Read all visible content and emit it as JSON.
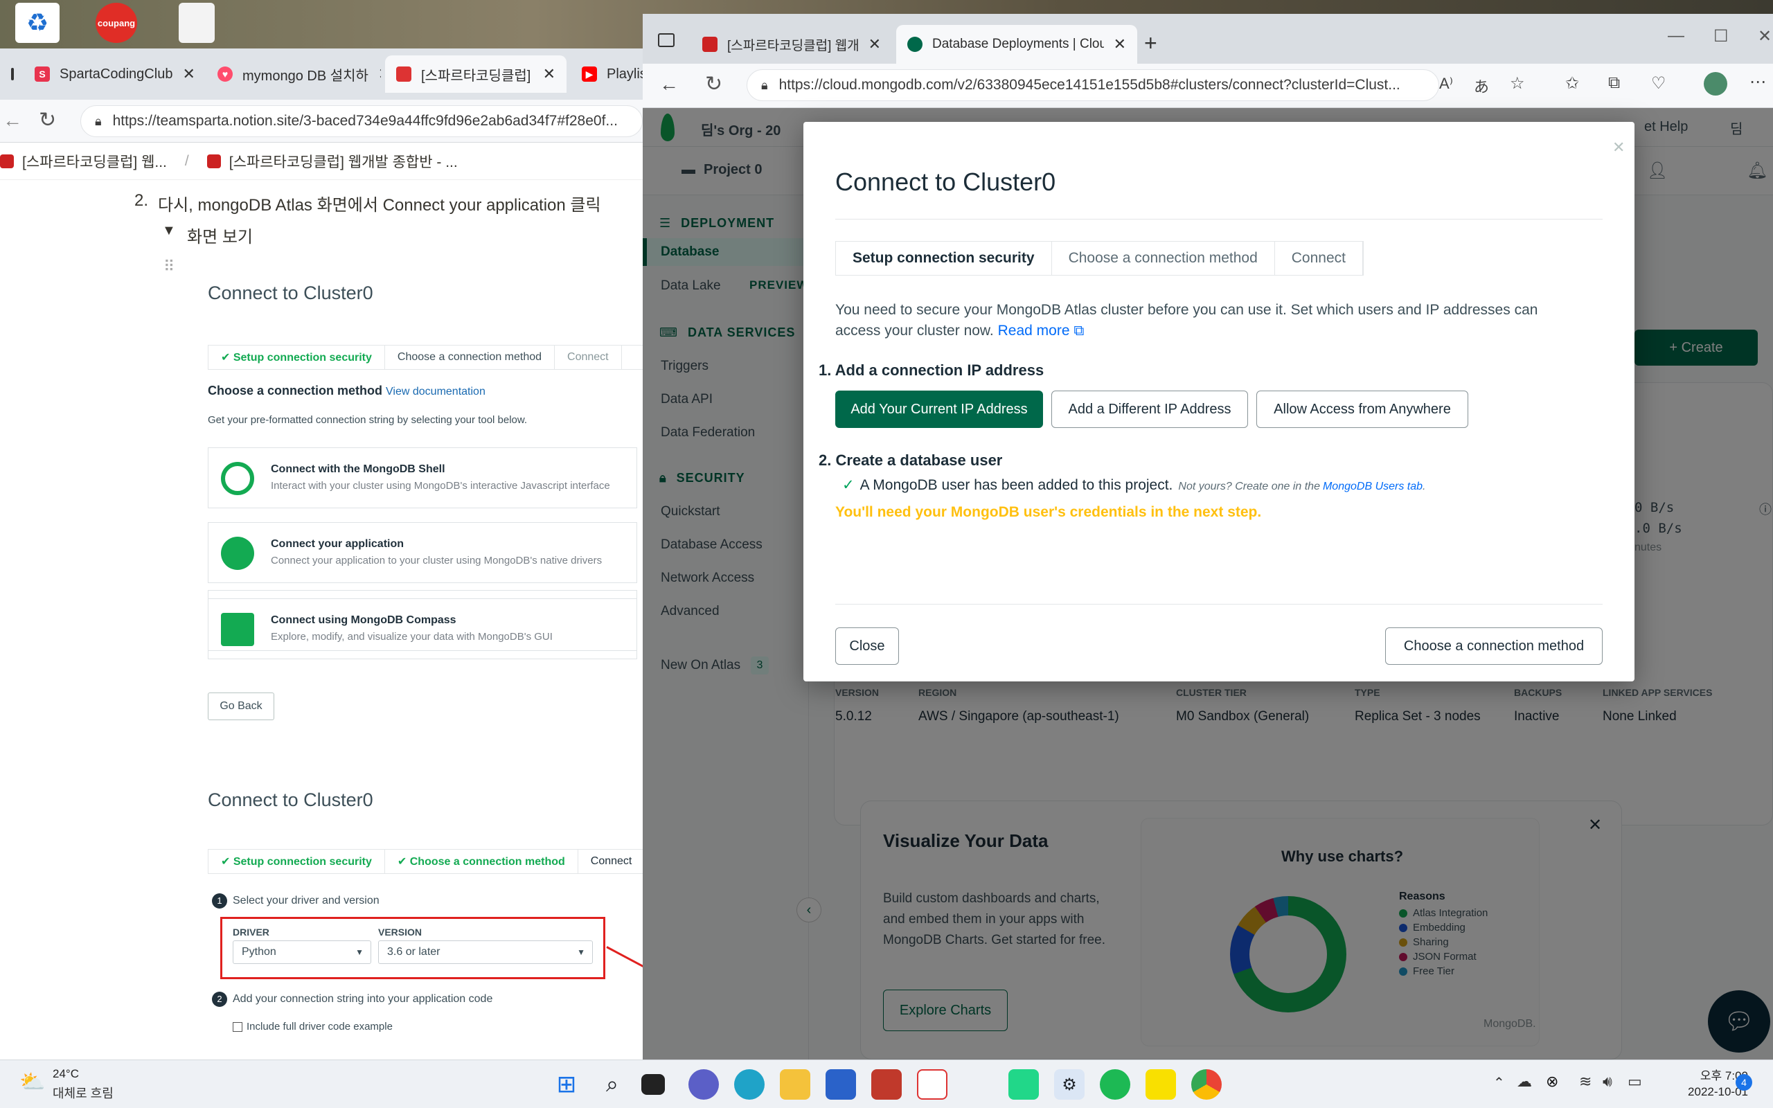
{
  "desktop": {
    "coupang_label": "coupang"
  },
  "left_browser": {
    "tabs": [
      {
        "label": "SpartaCodingClub"
      },
      {
        "label": "mymongo DB 설치하"
      },
      {
        "label": "[스파르타코딩클럽]"
      },
      {
        "label": "Playlis"
      }
    ],
    "url": "https://teamsparta.notion.site/3-baced734e9a44ffc9fd96e2ab6ad34f7#f28e0f...",
    "breadcrumb": [
      "[스파르타코딩클럽] 웹...",
      "/",
      "[스파르타코딩클럽] 웹개발 종합반 - ..."
    ],
    "step_number": "2.",
    "step_text": "다시, mongoDB Atlas 화면에서 Connect your application 클릭",
    "toggle_label": "화면 보기",
    "shot1": {
      "title": "Connect to Cluster0",
      "steps": [
        "✔ Setup connection security",
        "Choose a connection method",
        "Connect"
      ],
      "method_heading": "Choose a connection method",
      "view_docs": "View documentation",
      "subtitle": "Get your pre-formatted connection string by selecting your tool below.",
      "cards": [
        {
          "title": "Connect with the MongoDB Shell",
          "desc": "Interact with your cluster using MongoDB's interactive Javascript interface"
        },
        {
          "title": "Connect your application",
          "desc": "Connect your application to your cluster using MongoDB's native drivers"
        },
        {
          "title": "Connect using MongoDB Compass",
          "desc": "Explore, modify, and visualize your data with MongoDB's GUI"
        }
      ],
      "go_back": "Go Back"
    },
    "shot2": {
      "title": "Connect to Cluster0",
      "steps": [
        "✔ Setup connection security",
        "✔ Choose a connection method",
        "Connect"
      ],
      "step1": "Select your driver and version",
      "driver_label": "DRIVER",
      "driver_value": "Python",
      "version_label": "VERSION",
      "version_value": "3.6 or later",
      "step2": "Add your connection string into your application code",
      "include_full": "Include full driver code example"
    }
  },
  "right_browser": {
    "tabs": [
      {
        "label": "[스파르타코딩클럽] 웹개발 종합"
      },
      {
        "label": "Database Deployments | Cloud: I"
      }
    ],
    "url": "https://cloud.mongodb.com/v2/63380945ece14151e155d5b8#clusters/connect?clusterId=Clust...",
    "atlas": {
      "org": "딤's Org - 20",
      "get_help": "et Help",
      "user": "딤",
      "project": "Project 0",
      "sidebar": {
        "deployment": "DEPLOYMENT",
        "database": "Database",
        "data_lake": "Data Lake",
        "preview": "PREVIEW",
        "data_services": "DATA SERVICES",
        "triggers": "Triggers",
        "data_api": "Data API",
        "data_federation": "Data Federation",
        "security": "SECURITY",
        "quickstart": "Quickstart",
        "database_access": "Database Access",
        "network_access": "Network Access",
        "advanced": "Advanced",
        "new_on_atlas": "New On Atlas",
        "new_count": "3"
      },
      "create_button": "+ Create",
      "metrics": [
        "0 B/s",
        ".0 B/s",
        "nutes"
      ],
      "cluster_info": {
        "headers": [
          "VERSION",
          "REGION",
          "CLUSTER TIER",
          "TYPE",
          "BACKUPS",
          "LINKED APP SERVICES"
        ],
        "values": [
          "5.0.12",
          "AWS / Singapore (ap-southeast-1)",
          "M0 Sandbox (General)",
          "Replica Set - 3 nodes",
          "Inactive",
          "None Linked"
        ]
      },
      "visualize": {
        "title": "Visualize Your Data",
        "desc": [
          "Build custom dashboards and charts,",
          "and embed them in your apps with",
          "MongoDB Charts. Get started for free."
        ],
        "button": "Explore Charts",
        "chart_title": "Why use charts?",
        "reasons_label": "Reasons",
        "reasons": [
          "Atlas Integration",
          "Embedding",
          "Sharing",
          "JSON Format",
          "Free Tier"
        ],
        "reason_colors": [
          "#13aa52",
          "#1a56db",
          "#d4a017",
          "#c2185b",
          "#2196c9"
        ],
        "brand": "MongoDB."
      }
    },
    "modal": {
      "title": "Connect to Cluster0",
      "steps": [
        "Setup connection security",
        "Choose a connection method",
        "Connect"
      ],
      "intro": "You need to secure your MongoDB Atlas cluster before you can use it. Set which users and IP addresses can",
      "intro2": "access your cluster now.",
      "read_more": "Read more",
      "section1": "1. Add a connection IP address",
      "btn_current_ip": "Add Your Current IP Address",
      "btn_different_ip": "Add a Different IP Address",
      "btn_anywhere": "Allow Access from Anywhere",
      "section2": "2. Create a database user",
      "user_added": "A MongoDB user has been added to this project.",
      "not_yours": "Not yours? Create one in the",
      "users_tab": "MongoDB Users tab",
      "period": ".",
      "warning": "You'll need your MongoDB user's credentials in the next step.",
      "close": "Close",
      "next": "Choose a connection method"
    }
  },
  "taskbar": {
    "weather_temp": "24°C",
    "weather_desc": "대체로 흐림",
    "time": "오후 7:00",
    "date": "2022-10-01",
    "notification_count": "4"
  }
}
